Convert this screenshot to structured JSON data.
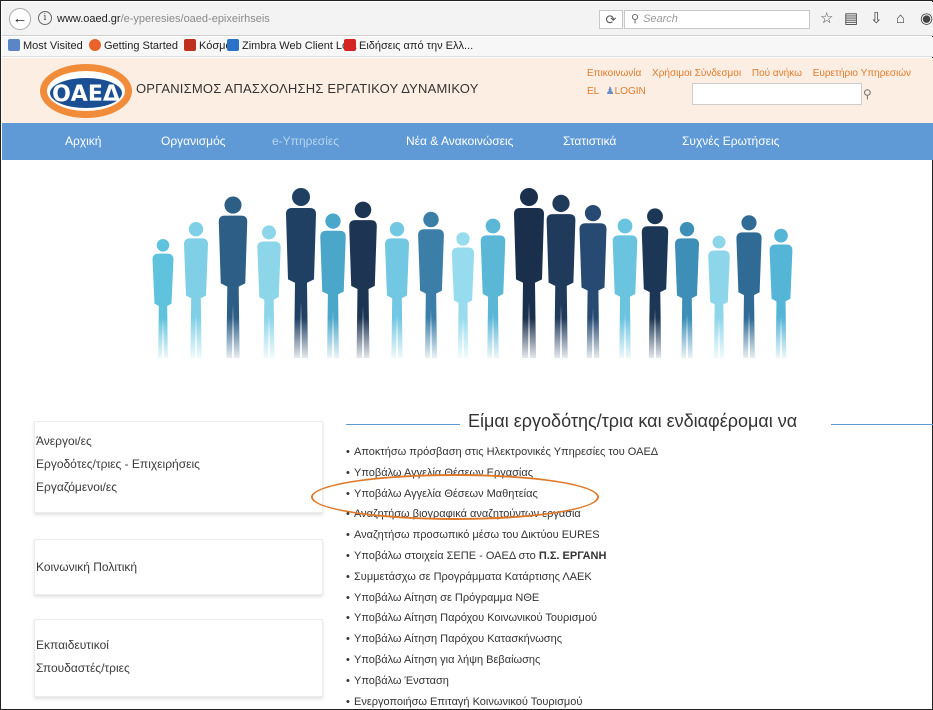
{
  "browser": {
    "url_host": "www.oaed.gr",
    "url_path": "/e-yperesies/oaed-epixeirhseis",
    "search_placeholder": "Search",
    "bookmarks": [
      "Most Visited",
      "Getting Started",
      "Κόσμος",
      "Zimbra Web Client Lo...",
      "Ειδήσεις από την Ελλ..."
    ]
  },
  "site": {
    "logo_text": "ΟΑΕΔ",
    "org_name": "ΟΡΓΑΝΙΣΜΟΣ ΑΠΑΣΧΟΛΗΣΗΣ ΕΡΓΑΤΙΚΟΥ ΔΥΝΑΜΙΚΟΥ",
    "top_links": [
      "Επικοινωνία",
      "Χρήσιμοι Σύνδεσμοι",
      "Πού ανήκω",
      "Ευρετήριο Υπηρεσιών"
    ],
    "lang": "EL",
    "login": "LOGIN"
  },
  "nav": [
    "Αρχική",
    "Οργανισμός",
    "e-Υπηρεσίες",
    "Νέα & Ανακοινώσεις",
    "Στατιστικά",
    "Συχνές Ερωτήσεις"
  ],
  "sidebar": {
    "group1": [
      "Άνεργοι/ες",
      "Εργοδότες/τριες - Επιχειρήσεις",
      "Εργαζόμενοι/ες"
    ],
    "group2": [
      "Κοινωνική Πολιτική"
    ],
    "group3": [
      "Εκπαιδευτικοί",
      "Σπουδαστές/τριες"
    ]
  },
  "main": {
    "heading": "Είμαι εργοδότης/τρια και ενδιαφέρομαι να",
    "items": [
      "Αποκτήσω πρόσβαση στις Ηλεκτρονικές Υπηρεσίες του ΟΑΕΔ",
      "Υποβάλω Αγγελία Θέσεων Εργασίας",
      "Υποβάλω Αγγελία Θέσεων Μαθητείας",
      "Αναζητήσω βιογραφικά αναζητούντων εργασία",
      "Αναζητήσω προσωπικό μέσω του Δικτύου EURES",
      "Υποβάλω στοιχεία ΣΕΠΕ - ΟΑΕΔ στο ",
      "Συμμετάσχω σε Προγράμματα Κατάρτισης ΛΑΕΚ",
      "Υποβάλω Αίτηση σε Πρόγραμμα ΝΘΕ",
      "Υποβάλω Αίτηση Παρόχου Κοινωνικού Τουρισμού",
      "Υποβάλω Αίτηση Παρόχου Κατασκήνωσης",
      "Υποβάλω Αίτηση για λήψη Βεβαίωσης",
      "Υποβάλω  Ένσταση",
      "Ενεργοποιήσω Επιταγή Κοινωνικού Τουρισμού"
    ],
    "item6_bold": "Π.Σ. ΕΡΓΑΝΗ"
  },
  "colors": {
    "brand_orange": "#e07a2a",
    "nav_blue": "#5f9ad6",
    "header_bg": "#fdeee3"
  }
}
